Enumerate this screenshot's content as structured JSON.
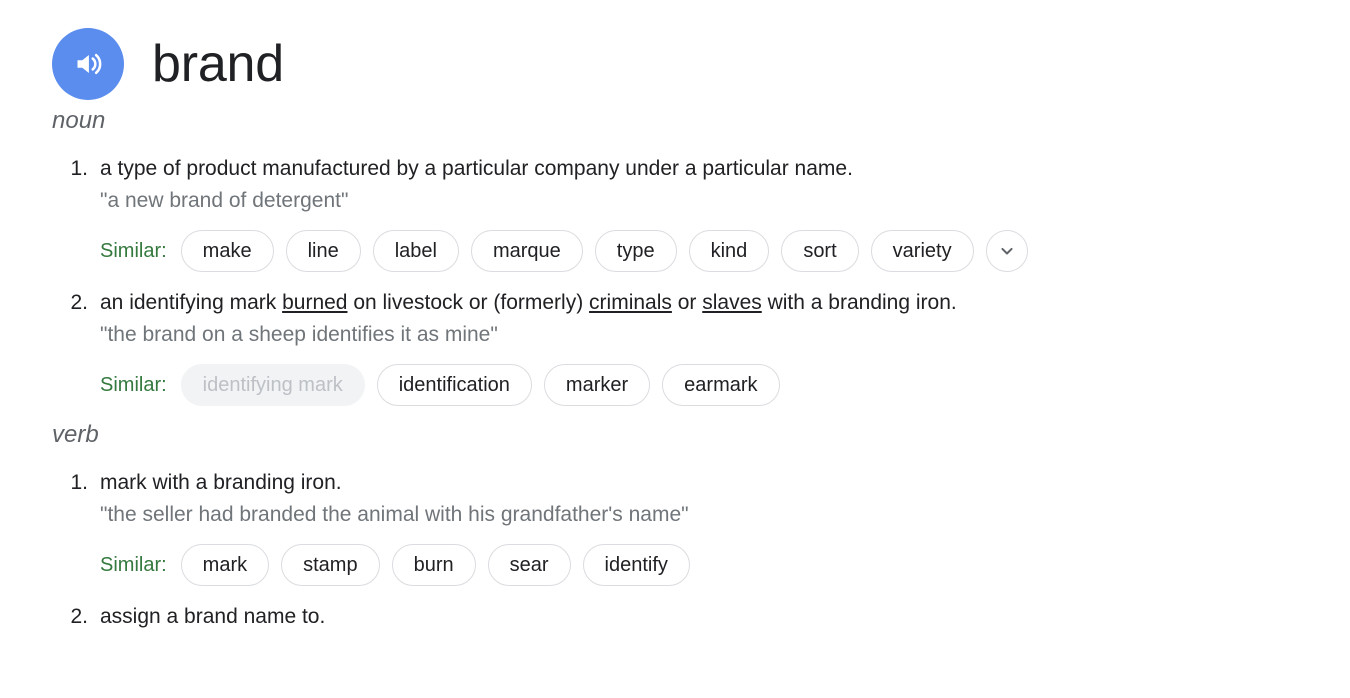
{
  "headword": {
    "term": "brand",
    "audio_icon": "speaker-volume-icon",
    "audio_color": "#5b8def"
  },
  "similar_label": "Similar:",
  "similar_label_color": "#34793e",
  "expand_icon": "chevron-down-icon",
  "entries": [
    {
      "part_of_speech": "noun",
      "senses": [
        {
          "number": "1.",
          "definition_parts": [
            {
              "text": "a type of product manufactured by a particular company under a particular name.",
              "link": false
            }
          ],
          "example": "\"a new brand of detergent\"",
          "similar": [
            {
              "text": "make",
              "muted": false
            },
            {
              "text": "line",
              "muted": false
            },
            {
              "text": "label",
              "muted": false
            },
            {
              "text": "marque",
              "muted": false
            },
            {
              "text": "type",
              "muted": false
            },
            {
              "text": "kind",
              "muted": false
            },
            {
              "text": "sort",
              "muted": false
            },
            {
              "text": "variety",
              "muted": false
            }
          ],
          "has_expand": true
        },
        {
          "number": "2.",
          "definition_parts": [
            {
              "text": "an identifying mark ",
              "link": false
            },
            {
              "text": "burned",
              "link": true
            },
            {
              "text": " on livestock or (formerly) ",
              "link": false
            },
            {
              "text": "criminals",
              "link": true
            },
            {
              "text": " or ",
              "link": false
            },
            {
              "text": "slaves",
              "link": true
            },
            {
              "text": " with a branding iron.",
              "link": false
            }
          ],
          "example": "\"the brand on a sheep identifies it as mine\"",
          "similar": [
            {
              "text": "identifying mark",
              "muted": true
            },
            {
              "text": "identification",
              "muted": false
            },
            {
              "text": "marker",
              "muted": false
            },
            {
              "text": "earmark",
              "muted": false
            }
          ],
          "has_expand": false
        }
      ]
    },
    {
      "part_of_speech": "verb",
      "senses": [
        {
          "number": "1.",
          "definition_parts": [
            {
              "text": "mark with a branding iron.",
              "link": false
            }
          ],
          "example": "\"the seller had branded the animal with his grandfather's name\"",
          "similar": [
            {
              "text": "mark",
              "muted": false
            },
            {
              "text": "stamp",
              "muted": false
            },
            {
              "text": "burn",
              "muted": false
            },
            {
              "text": "sear",
              "muted": false
            },
            {
              "text": "identify",
              "muted": false
            }
          ],
          "has_expand": false
        },
        {
          "number": "2.",
          "definition_parts": [
            {
              "text": "assign a brand name to.",
              "link": false
            }
          ],
          "example": "",
          "similar": [],
          "has_expand": false
        }
      ]
    }
  ]
}
